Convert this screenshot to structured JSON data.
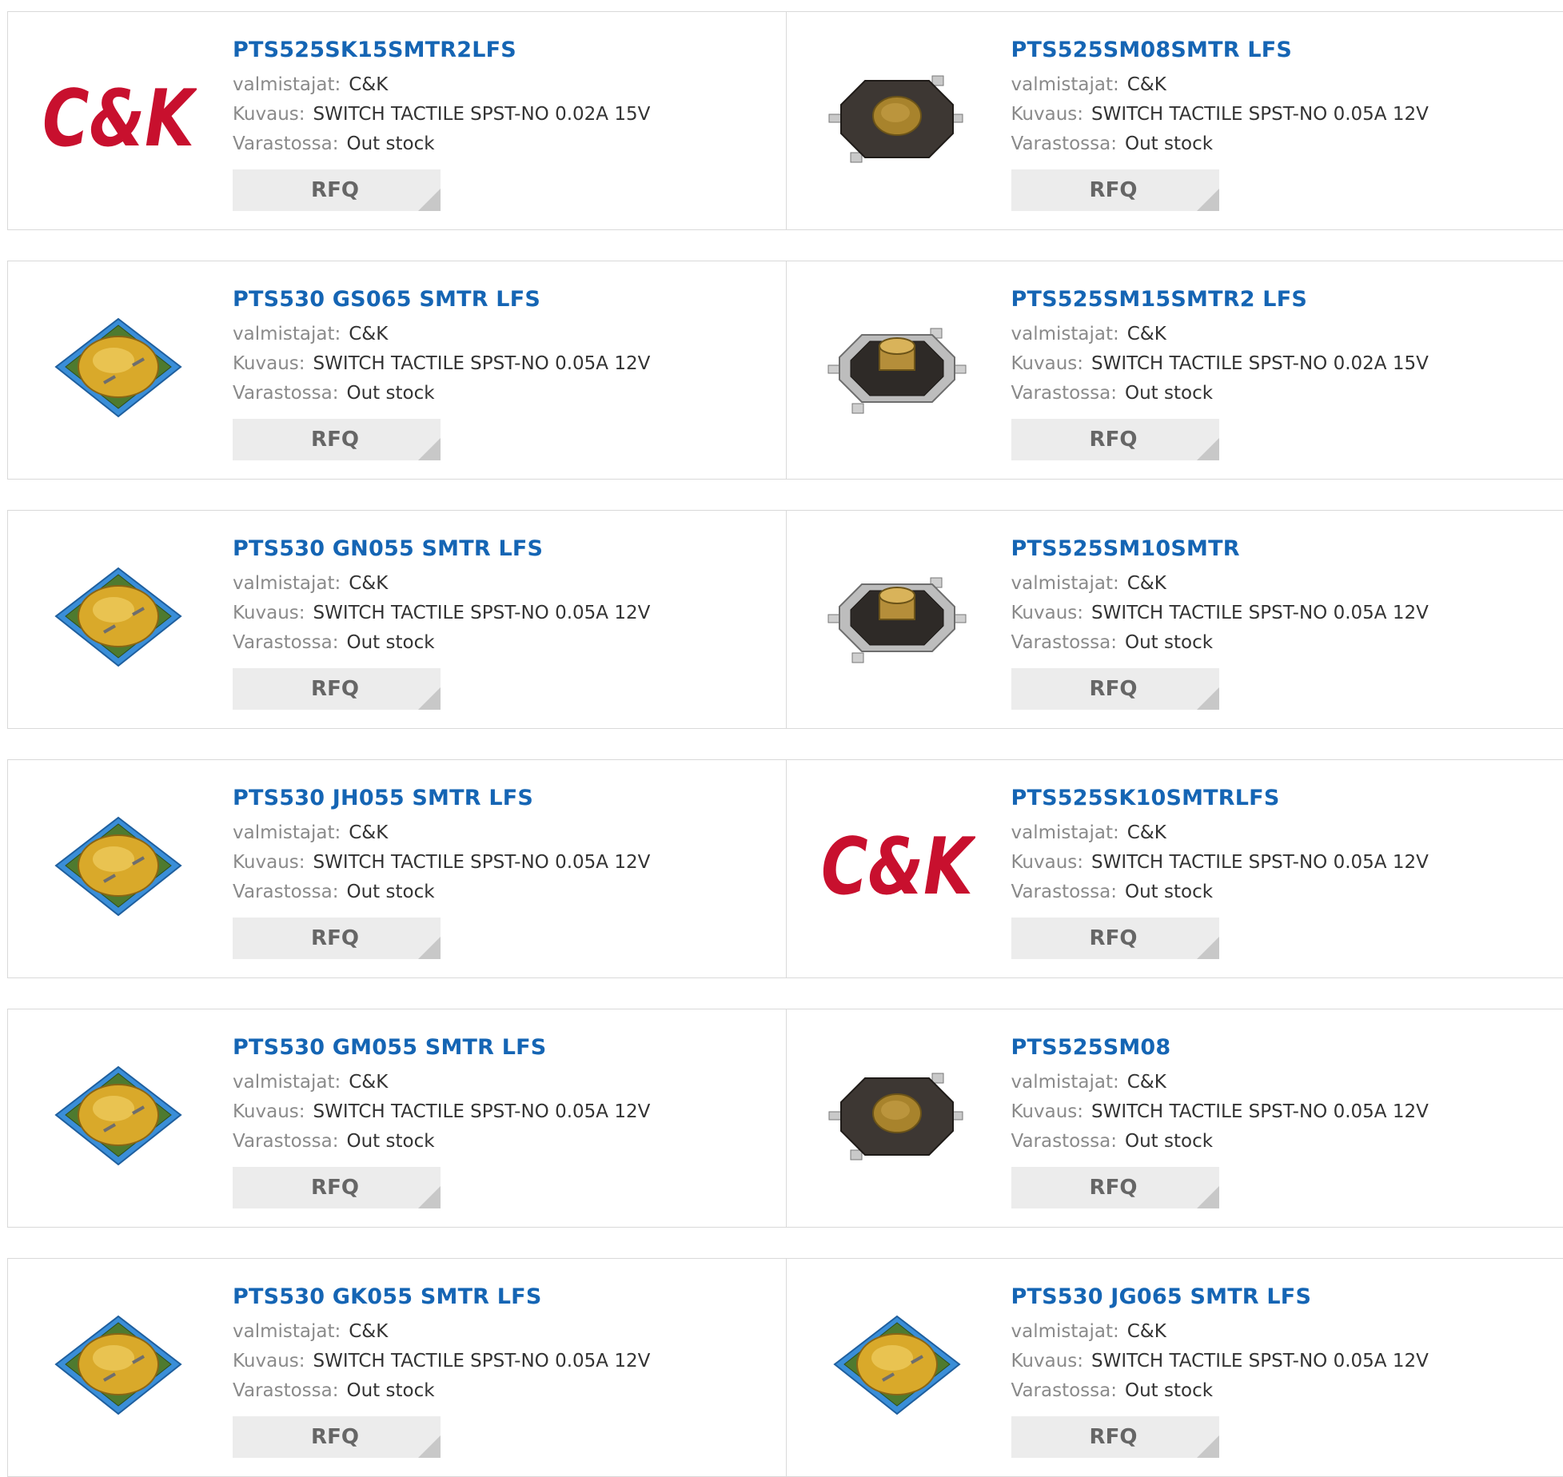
{
  "labels": {
    "manufacturer": "valmistajat:",
    "description": "Kuvaus:",
    "stock": "Varastossa:",
    "rfq": "RFQ"
  },
  "colors": {
    "title_link": "#1565b4",
    "label": "#8a8a8a",
    "rfq_bg": "#ececec",
    "ck_logo_red": "#c8102e"
  },
  "products": [
    {
      "part": "PTS525SK15SMTR2LFS",
      "manufacturer": "C&K",
      "description": "SWITCH TACTILE SPST-NO 0.02A 15V",
      "stock": "Out stock",
      "image": "ck-logo"
    },
    {
      "part": "PTS525SM08SMTR LFS",
      "manufacturer": "C&K",
      "description": "SWITCH TACTILE SPST-NO 0.05A 12V",
      "stock": "Out stock",
      "image": "tactile-switch-flat"
    },
    {
      "part": "PTS530 GS065 SMTR LFS",
      "manufacturer": "C&K",
      "description": "SWITCH TACTILE SPST-NO 0.05A 12V",
      "stock": "Out stock",
      "image": "tactile-switch-blue"
    },
    {
      "part": "PTS525SM15SMTR2 LFS",
      "manufacturer": "C&K",
      "description": "SWITCH TACTILE SPST-NO 0.02A 15V",
      "stock": "Out stock",
      "image": "tactile-switch-raised"
    },
    {
      "part": "PTS530 GN055 SMTR LFS",
      "manufacturer": "C&K",
      "description": "SWITCH TACTILE SPST-NO 0.05A 12V",
      "stock": "Out stock",
      "image": "tactile-switch-blue"
    },
    {
      "part": "PTS525SM10SMTR",
      "manufacturer": "C&K",
      "description": "SWITCH TACTILE SPST-NO 0.05A 12V",
      "stock": "Out stock",
      "image": "tactile-switch-raised"
    },
    {
      "part": "PTS530 JH055 SMTR LFS",
      "manufacturer": "C&K",
      "description": "SWITCH TACTILE SPST-NO 0.05A 12V",
      "stock": "Out stock",
      "image": "tactile-switch-blue"
    },
    {
      "part": "PTS525SK10SMTRLFS",
      "manufacturer": "C&K",
      "description": "SWITCH TACTILE SPST-NO 0.05A 12V",
      "stock": "Out stock",
      "image": "ck-logo"
    },
    {
      "part": "PTS530 GM055 SMTR LFS",
      "manufacturer": "C&K",
      "description": "SWITCH TACTILE SPST-NO 0.05A 12V",
      "stock": "Out stock",
      "image": "tactile-switch-blue"
    },
    {
      "part": "PTS525SM08",
      "manufacturer": "C&K",
      "description": "SWITCH TACTILE SPST-NO 0.05A 12V",
      "stock": "Out stock",
      "image": "tactile-switch-flat"
    },
    {
      "part": "PTS530 GK055 SMTR LFS",
      "manufacturer": "C&K",
      "description": "SWITCH TACTILE SPST-NO 0.05A 12V",
      "stock": "Out stock",
      "image": "tactile-switch-blue"
    },
    {
      "part": "PTS530 JG065 SMTR LFS",
      "manufacturer": "C&K",
      "description": "SWITCH TACTILE SPST-NO 0.05A 12V",
      "stock": "Out stock",
      "image": "tactile-switch-blue"
    }
  ]
}
